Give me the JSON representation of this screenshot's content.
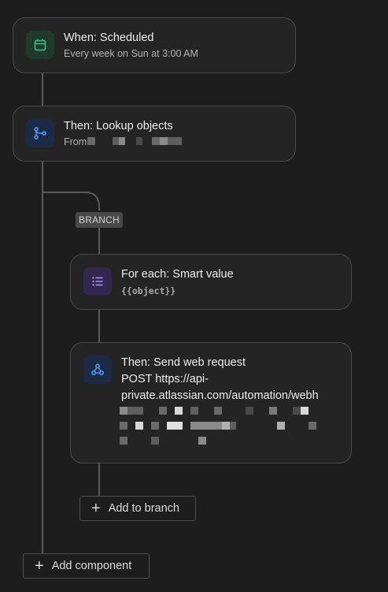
{
  "trigger": {
    "title": "When: Scheduled",
    "subtitle": "Every week on Sun at 3:00 AM",
    "icon": "calendar-icon",
    "accent": "#3fbf7f"
  },
  "lookup": {
    "title": "Then: Lookup objects",
    "subtitle": "From",
    "icon": "branch-icon",
    "accent": "#579dff"
  },
  "branch": {
    "label": "BRANCH"
  },
  "foreach": {
    "title": "For each: Smart value",
    "smart_value": "{{object}}",
    "icon": "list-icon",
    "accent": "#9f8fef"
  },
  "webrequest": {
    "title": "Then: Send web request",
    "line1": "POST https://api-",
    "line2": "private.atlassian.com/automation/webh",
    "icon": "webhook-icon",
    "accent": "#579dff"
  },
  "buttons": {
    "add_to_branch": "Add to branch",
    "add_component": "Add component"
  }
}
